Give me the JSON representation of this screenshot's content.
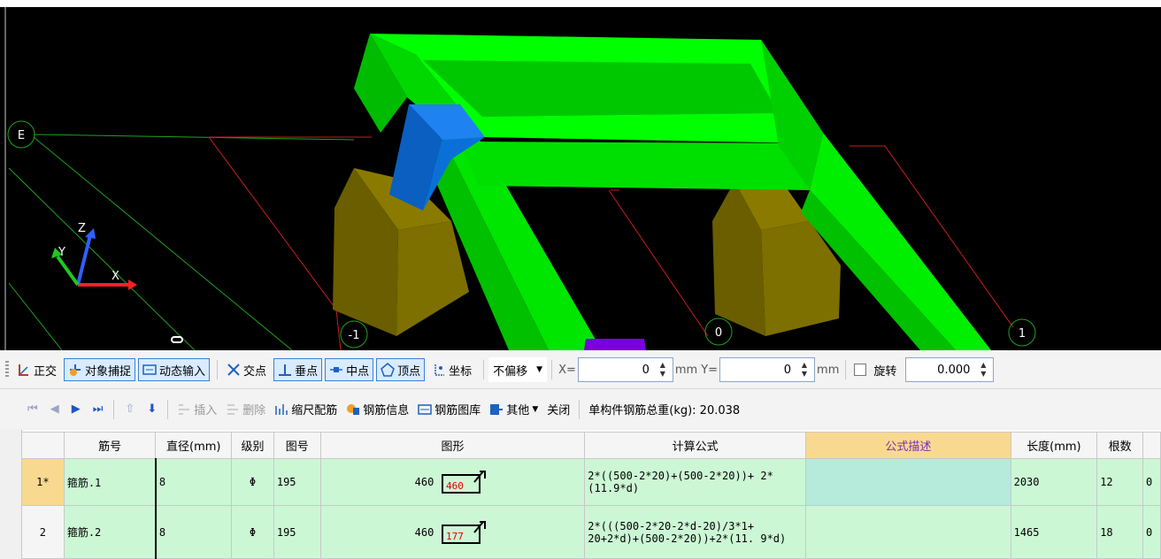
{
  "viewport": {
    "axis_labels": [
      "E",
      "-1",
      "0",
      "1"
    ],
    "triad": {
      "x": "X",
      "y": "Y",
      "z": "Z"
    },
    "colors": {
      "background": "#000000",
      "beam": "#00e600",
      "column": "#7a6a00",
      "block": "#0a63c9"
    }
  },
  "snap_toolbar": {
    "items": [
      {
        "label": "正交",
        "icon": "ortho-icon",
        "on": false
      },
      {
        "label": "对象捕捉",
        "icon": "object-snap-icon",
        "on": true
      },
      {
        "label": "动态输入",
        "icon": "dynamic-input-icon",
        "on": true
      },
      {
        "label": "交点",
        "icon": "intersection-icon",
        "on": false
      },
      {
        "label": "垂点",
        "icon": "perpendicular-icon",
        "on": true
      },
      {
        "label": "中点",
        "icon": "midpoint-icon",
        "on": true
      },
      {
        "label": "顶点",
        "icon": "vertex-icon",
        "on": true
      },
      {
        "label": "坐标",
        "icon": "coordinate-icon",
        "on": false
      }
    ],
    "offset_select": "不偏移",
    "x_label": "X=",
    "x_value": "0",
    "unit1": "mm",
    "y_label": "Y=",
    "y_value": "0",
    "unit2": "mm",
    "rotate_label": "旋转",
    "rotate_value": "0.000"
  },
  "panel_toolbar": {
    "insert": "插入",
    "delete": "删除",
    "scale_rebar": "缩尺配筋",
    "rebar_info": "钢筋信息",
    "rebar_library": "钢筋图库",
    "other": "其他",
    "close": "关闭",
    "total_weight": "单构件钢筋总重(kg): 20.038"
  },
  "table": {
    "headers": [
      "",
      "筋号",
      "直径(mm)",
      "级别",
      "图号",
      "图形",
      "计算公式",
      "公式描述",
      "长度(mm)",
      "根数",
      ""
    ],
    "rows": [
      {
        "num": "1*",
        "name": "箍筋.1",
        "dia": "8",
        "grade": "Φ",
        "fig": "195",
        "shape_w": "460",
        "shape_h": "460",
        "formula": "2*((500-2*20)+(500-2*20))+ 2*(11.9*d)",
        "desc": "",
        "length": "2030",
        "count": "12",
        "extra": "0"
      },
      {
        "num": "2",
        "name": "箍筋.2",
        "dia": "8",
        "grade": "Φ",
        "fig": "195",
        "shape_w": "460",
        "shape_h": "177",
        "formula": "2*(((500-2*20-2*d-20)/3*1+ 20+2*d)+(500-2*20))+2*(11. 9*d)",
        "desc": "",
        "length": "1465",
        "count": "18",
        "extra": "0"
      }
    ]
  }
}
